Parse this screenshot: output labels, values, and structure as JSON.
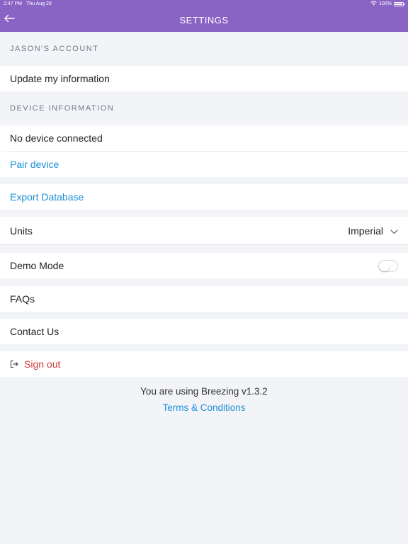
{
  "status_bar": {
    "time": "2:47 PM",
    "date": "Thu Aug 29",
    "battery": "100%",
    "icons": [
      "wifi-icon",
      "battery-icon"
    ]
  },
  "header": {
    "title": "SETTINGS",
    "back_icon": "arrow-left-icon",
    "color": "#8a64c4"
  },
  "account": {
    "section_title": "JASON'S ACCOUNT",
    "update_label": "Update my information"
  },
  "device": {
    "section_title": "DEVICE INFORMATION",
    "status_label": "No device connected",
    "pair_label": "Pair device"
  },
  "export": {
    "label": "Export Database"
  },
  "units": {
    "label": "Units",
    "value": "Imperial",
    "chevron_icon": "chevron-down-icon"
  },
  "demo": {
    "label": "Demo Mode",
    "enabled": false
  },
  "faqs": {
    "label": "FAQs"
  },
  "contact": {
    "label": "Contact Us"
  },
  "signout": {
    "label": "Sign out",
    "icon": "sign-out-icon",
    "color": "#cf3a3a"
  },
  "footer": {
    "version_text": "You are using Breezing v1.3.2",
    "terms_label": "Terms & Conditions"
  },
  "colors": {
    "link": "#1e8fd8",
    "background": "#f3f4f8",
    "section_text": "#707785"
  }
}
